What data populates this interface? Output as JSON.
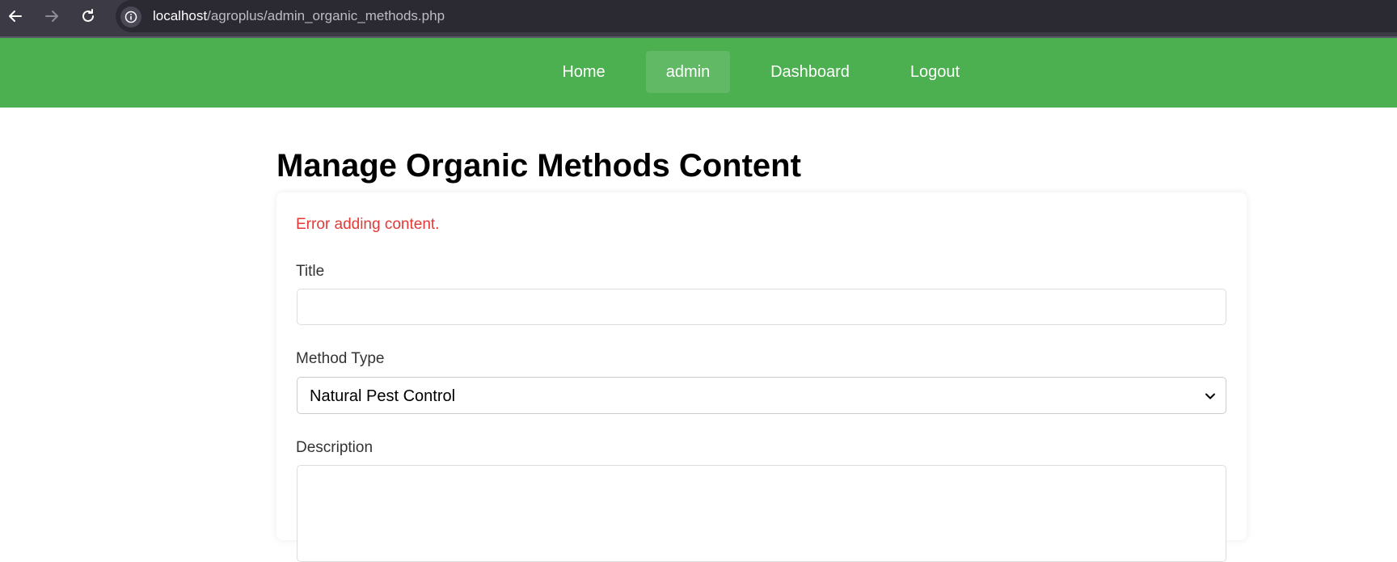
{
  "browser": {
    "url_host": "localhost",
    "url_path": "/agroplus/admin_organic_methods.php",
    "back_icon": "back-arrow-icon",
    "forward_icon": "forward-arrow-icon",
    "reload_icon": "reload-icon",
    "info_icon": "info-icon"
  },
  "nav": {
    "items": [
      {
        "label": "Home"
      },
      {
        "label": "admin"
      },
      {
        "label": "Dashboard"
      },
      {
        "label": "Logout"
      }
    ],
    "active_index": 1,
    "bg_color": "#4caf50"
  },
  "page": {
    "title": "Manage Organic Methods Content"
  },
  "form": {
    "error_message": "Error adding content.",
    "error_color": "#e53935",
    "title_label": "Title",
    "title_value": "",
    "method_type_label": "Method Type",
    "method_type_selected": "Natural Pest Control",
    "description_label": "Description",
    "description_value": ""
  }
}
